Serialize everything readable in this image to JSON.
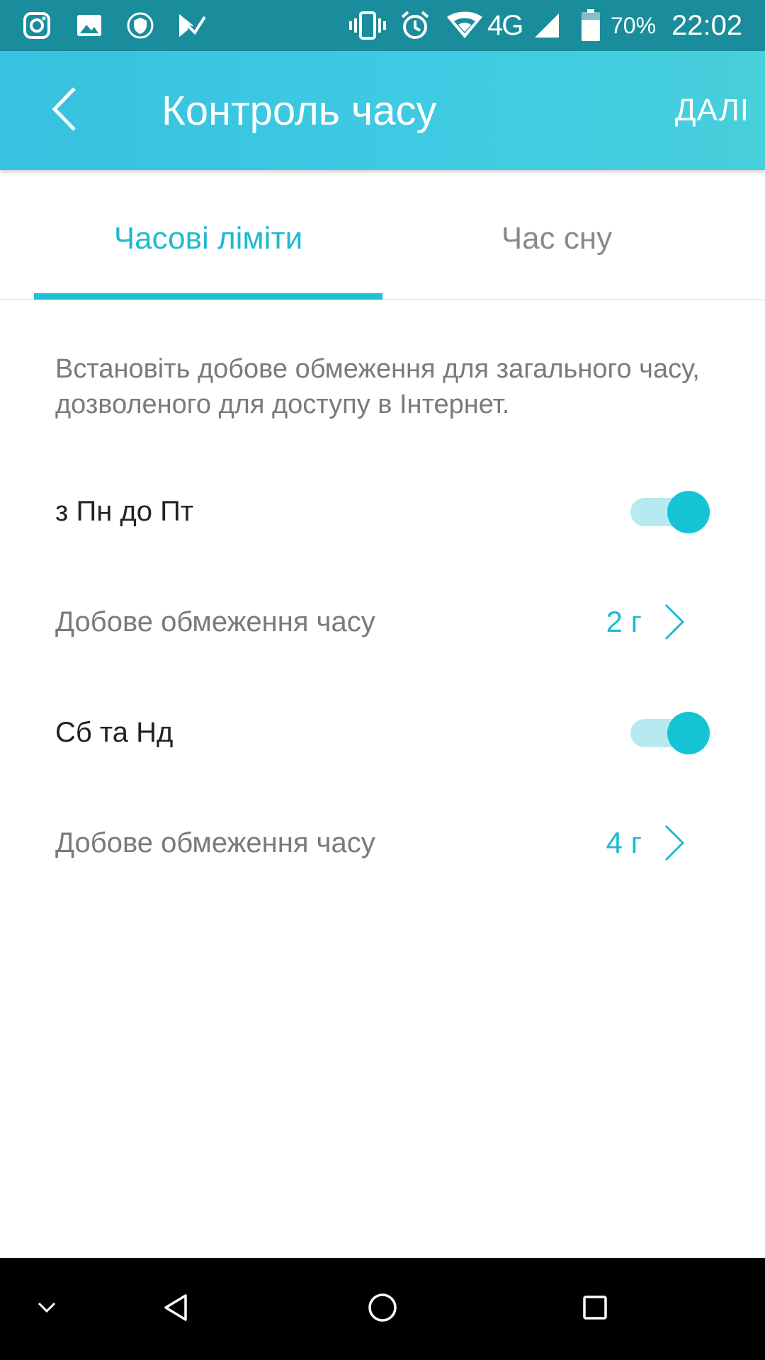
{
  "status_bar": {
    "left_icons": [
      "instagram-icon",
      "gallery-icon",
      "shield-icon",
      "check-list-icon"
    ],
    "right_icons": [
      "vibrate-icon",
      "alarm-icon",
      "wifi-icon",
      "signal-icon",
      "battery-icon"
    ],
    "network": "4G",
    "battery": "70%",
    "time": "22:02"
  },
  "app_bar": {
    "title": "Контроль часу",
    "next_label": "ДАЛІ"
  },
  "tabs": [
    {
      "label": "Часові ліміти",
      "active": true
    },
    {
      "label": "Час сну",
      "active": false
    }
  ],
  "description": "Встановіть добове обмеження для загального часу, дозволеного для доступу в Інтернет.",
  "weekdays": {
    "label": "з Пн до Пт",
    "enabled": true,
    "limit_label": "Добове обмеження часу",
    "limit_value": "2 г"
  },
  "weekend": {
    "label": "Сб та Нд",
    "enabled": true,
    "limit_label": "Добове обмеження часу",
    "limit_value": "4 г"
  },
  "colors": {
    "accent": "#1fc1d6",
    "status_bar": "#1a8d9c",
    "app_bar": "#3fcbe2"
  }
}
